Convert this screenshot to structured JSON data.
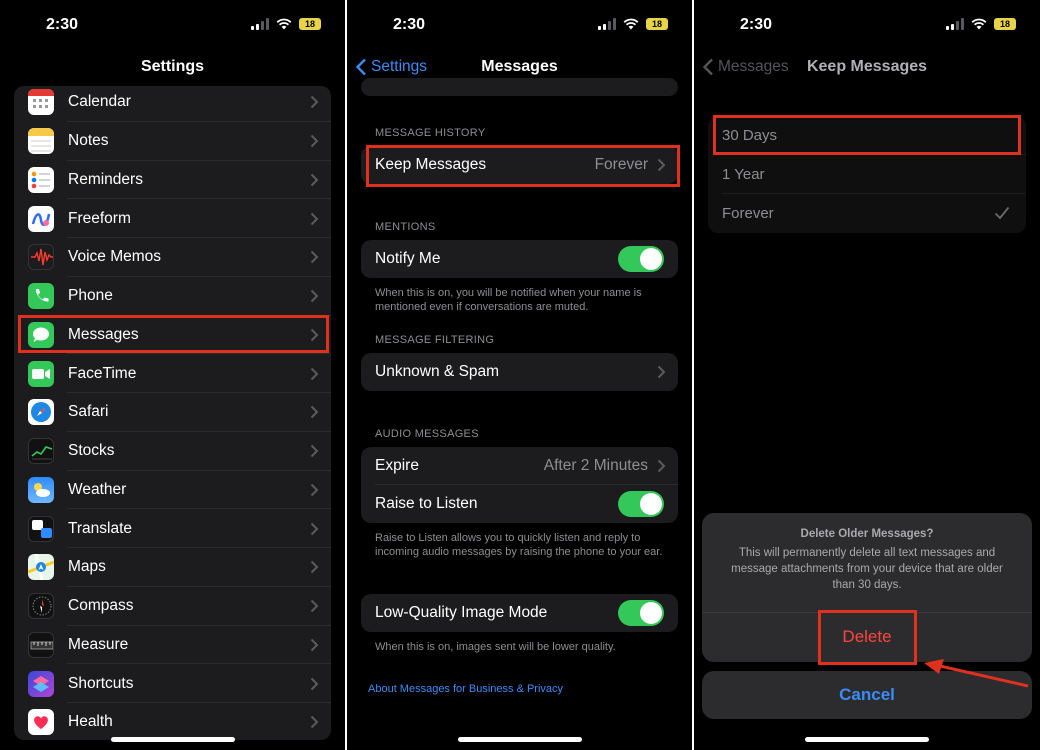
{
  "status": {
    "time": "2:30",
    "battery": "18"
  },
  "settings_screen": {
    "title": "Settings",
    "items": [
      {
        "label": "Calendar",
        "icon": "calendar-icon"
      },
      {
        "label": "Notes",
        "icon": "notes-icon"
      },
      {
        "label": "Reminders",
        "icon": "reminders-icon"
      },
      {
        "label": "Freeform",
        "icon": "freeform-icon"
      },
      {
        "label": "Voice Memos",
        "icon": "voice-memos-icon"
      },
      {
        "label": "Phone",
        "icon": "phone-icon"
      },
      {
        "label": "Messages",
        "icon": "messages-icon"
      },
      {
        "label": "FaceTime",
        "icon": "facetime-icon"
      },
      {
        "label": "Safari",
        "icon": "safari-icon"
      },
      {
        "label": "Stocks",
        "icon": "stocks-icon"
      },
      {
        "label": "Weather",
        "icon": "weather-icon"
      },
      {
        "label": "Translate",
        "icon": "translate-icon"
      },
      {
        "label": "Maps",
        "icon": "maps-icon"
      },
      {
        "label": "Compass",
        "icon": "compass-icon"
      },
      {
        "label": "Measure",
        "icon": "measure-icon"
      },
      {
        "label": "Shortcuts",
        "icon": "shortcuts-icon"
      },
      {
        "label": "Health",
        "icon": "health-icon"
      }
    ]
  },
  "messages_screen": {
    "back": "Settings",
    "title": "Messages",
    "history_header": "MESSAGE HISTORY",
    "keep_messages": {
      "label": "Keep Messages",
      "value": "Forever"
    },
    "mentions_header": "MENTIONS",
    "notify_me": {
      "label": "Notify Me",
      "on": true
    },
    "notify_footer": "When this is on, you will be notified when your name is mentioned even if conversations are muted.",
    "filtering_header": "MESSAGE FILTERING",
    "unknown_spam": "Unknown & Spam",
    "audio_header": "AUDIO MESSAGES",
    "expire": {
      "label": "Expire",
      "value": "After 2 Minutes"
    },
    "raise_to_listen": {
      "label": "Raise to Listen",
      "on": true
    },
    "raise_footer": "Raise to Listen allows you to quickly listen and reply to incoming audio messages by raising the phone to your ear.",
    "low_quality": {
      "label": "Low-Quality Image Mode",
      "on": true
    },
    "low_quality_footer": "When this is on, images sent will be lower quality.",
    "business_link": "About Messages for Business & Privacy"
  },
  "keep_screen": {
    "back": "Messages",
    "title": "Keep Messages",
    "options": [
      "30 Days",
      "1 Year",
      "Forever"
    ],
    "selected": "Forever",
    "dialog": {
      "title": "Delete Older Messages?",
      "message": "This will permanently delete all text messages and message attachments from your device that are older than 30 days.",
      "delete": "Delete",
      "cancel": "Cancel"
    }
  },
  "colors": {
    "accent_blue": "#3b8cf5",
    "toggle_green": "#34c759",
    "destructive_red": "#ff453a",
    "highlight_red": "#e0301e"
  }
}
